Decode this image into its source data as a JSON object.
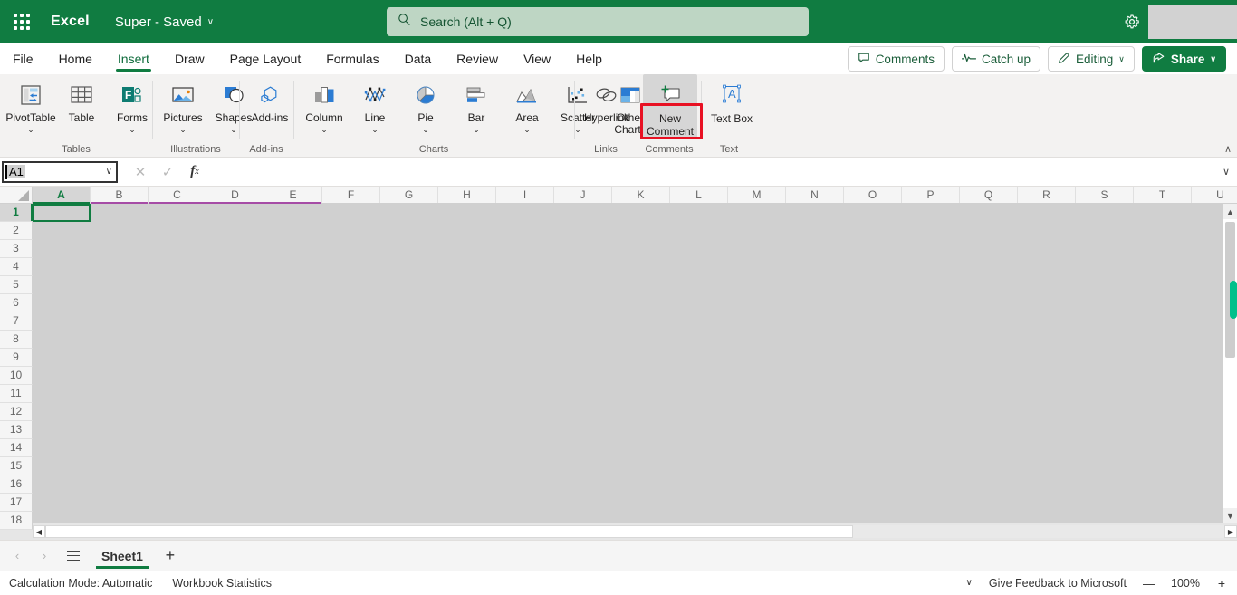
{
  "titlebar": {
    "app_name": "Excel",
    "doc_title": "Super  -  Saved",
    "waffle_icon": "app-launcher-icon",
    "chevron": "∨",
    "search": {
      "placeholder": "Search (Alt + Q)",
      "icon": "search-icon"
    },
    "gear_icon": "gear-icon"
  },
  "tabs": [
    {
      "label": "File",
      "active": false
    },
    {
      "label": "Home",
      "active": false
    },
    {
      "label": "Insert",
      "active": true
    },
    {
      "label": "Draw",
      "active": false
    },
    {
      "label": "Page Layout",
      "active": false
    },
    {
      "label": "Formulas",
      "active": false
    },
    {
      "label": "Data",
      "active": false
    },
    {
      "label": "Review",
      "active": false
    },
    {
      "label": "View",
      "active": false
    },
    {
      "label": "Help",
      "active": false
    }
  ],
  "tabbar_buttons": {
    "comments": "Comments",
    "catch_up": "Catch up",
    "editing": "Editing",
    "share": "Share",
    "chevron": "∨"
  },
  "ribbon": {
    "collapse_chevron": "∧",
    "groups": [
      {
        "name": "Tables",
        "items": [
          {
            "label": "PivotTable",
            "icon": "pivot-table-icon",
            "dropdown": true
          },
          {
            "label": "Table",
            "icon": "table-icon",
            "dropdown": false
          },
          {
            "label": "Forms",
            "icon": "forms-icon",
            "dropdown": true
          }
        ]
      },
      {
        "name": "Illustrations",
        "items": [
          {
            "label": "Pictures",
            "icon": "pictures-icon",
            "dropdown": true
          },
          {
            "label": "Shapes",
            "icon": "shapes-icon",
            "dropdown": true
          }
        ]
      },
      {
        "name": "Add-ins",
        "items": [
          {
            "label": "Add-ins",
            "icon": "addins-icon",
            "dropdown": false
          }
        ]
      },
      {
        "name": "Charts",
        "items": [
          {
            "label": "Column",
            "icon": "column-chart-icon",
            "dropdown": true
          },
          {
            "label": "Line",
            "icon": "line-chart-icon",
            "dropdown": true
          },
          {
            "label": "Pie",
            "icon": "pie-chart-icon",
            "dropdown": true
          },
          {
            "label": "Bar",
            "icon": "bar-chart-icon",
            "dropdown": true
          },
          {
            "label": "Area",
            "icon": "area-chart-icon",
            "dropdown": true
          },
          {
            "label": "Scatter",
            "icon": "scatter-chart-icon",
            "dropdown": true
          },
          {
            "label": "Other Charts",
            "icon": "other-charts-icon",
            "dropdown": true
          }
        ]
      },
      {
        "name": "Links",
        "items": [
          {
            "label": "Hyperlink",
            "icon": "hyperlink-icon",
            "dropdown": false
          }
        ]
      },
      {
        "name": "Comments",
        "items": [
          {
            "label": "New Comment",
            "icon": "new-comment-icon",
            "dropdown": false,
            "highlighted": true,
            "hovered": true
          }
        ]
      },
      {
        "name": "Text",
        "items": [
          {
            "label": "Text Box",
            "icon": "text-box-icon",
            "dropdown": false
          }
        ]
      }
    ]
  },
  "formula_bar": {
    "name_box_value": "A1",
    "cancel_icon": "cancel-icon",
    "confirm_icon": "confirm-icon",
    "function_icon": "fx-icon",
    "formula_value": "",
    "expand_chevron": "∨",
    "chevron": "∨"
  },
  "grid": {
    "columns": [
      "A",
      "B",
      "C",
      "D",
      "E",
      "F",
      "G",
      "H",
      "I",
      "J",
      "K",
      "L",
      "M",
      "N",
      "O",
      "P",
      "Q",
      "R",
      "S",
      "T",
      "U"
    ],
    "selected_column": "A",
    "purple_underline_columns": [
      "B",
      "C",
      "D",
      "E"
    ],
    "rows": [
      "1",
      "2",
      "3",
      "4",
      "5",
      "6",
      "7",
      "8",
      "9",
      "10",
      "11",
      "12",
      "13",
      "14",
      "15",
      "16",
      "17",
      "18"
    ],
    "selected_row": "1",
    "active_cell": "A1",
    "scroll_up_icon": "▲",
    "scroll_down_icon": "▼",
    "scroll_left_icon": "◀",
    "scroll_right_icon": "▶"
  },
  "sheetbar": {
    "prev_icon": "‹",
    "next_icon": "›",
    "all_sheets_icon": "all-sheets-icon",
    "sheets": [
      {
        "label": "Sheet1",
        "active": true
      }
    ],
    "add_sheet_icon": "+"
  },
  "statusbar": {
    "calculation_mode": "Calculation Mode: Automatic",
    "workbook_statistics": "Workbook Statistics",
    "chevron": "∨",
    "feedback": "Give Feedback to Microsoft",
    "zoom_out_icon": "—",
    "zoom_level": "100%",
    "zoom_in_icon": "+"
  },
  "colors": {
    "brand_green": "#107C41",
    "search_bg": "#BED6C4",
    "highlight_red": "#E81123",
    "purple_underline": "#A64CA6",
    "grid_bg": "#D0D0D0",
    "accent_teal": "#00C08B"
  }
}
